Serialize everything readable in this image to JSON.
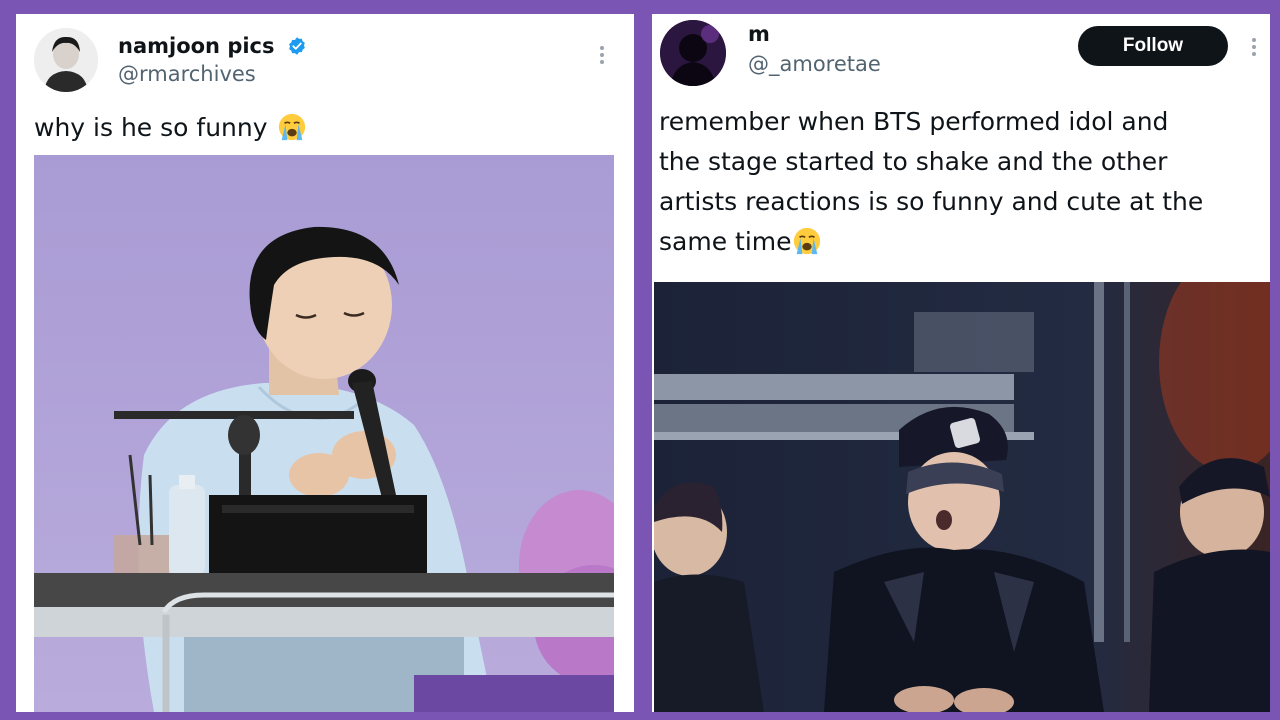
{
  "tweets": [
    {
      "display_name": "namjoon pics",
      "handle": "@rmarchives",
      "verified": true,
      "text": "why is he so funny",
      "emoji": "loudly-crying-face",
      "media": "photo-man-singing-into-microphone-at-desk"
    },
    {
      "display_name": "m",
      "handle": "@_amoretae",
      "verified": false,
      "follow_label": "Follow",
      "text_lines": [
        "remember when BTS performed idol and",
        "the stage started to shake and the other",
        "artists reactions is so funny and cute at the",
        "same time"
      ],
      "emoji": "loudly-crying-face",
      "media": "photo-artists-reacting-in-audience"
    }
  ],
  "colors": {
    "frame": "#7a55b3",
    "card": "#ffffff",
    "text": "#0f1419",
    "secondary": "#536471",
    "verified": "#1d9bf0",
    "follow_button": "#0f1419"
  }
}
